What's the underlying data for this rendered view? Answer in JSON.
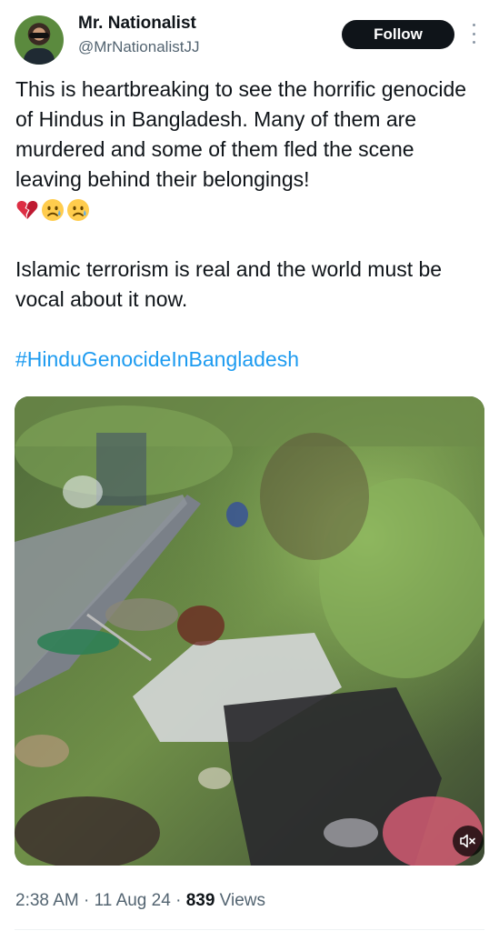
{
  "author": {
    "name": "Mr. Nationalist",
    "handle": "@MrNationalistJJ"
  },
  "follow_label": "Follow",
  "tweet": {
    "paragraph1": "This is heartbreaking to see the horrific genocide of Hindus in Bangladesh. Many of them are murdered and some of them fled the scene leaving behind their belongings!",
    "emojis": [
      "broken-heart-emoji",
      "sad-relieved-face-emoji",
      "sad-relieved-face-emoji"
    ],
    "paragraph2": "Islamic terrorism is real and the world must be vocal about it now.",
    "hashtag": "#HinduGenocideInBangladesh"
  },
  "meta": {
    "time": "2:38 AM",
    "sep1": " · ",
    "date": "11 Aug 24",
    "sep2": " · ",
    "views_count": "839",
    "views_label": " Views"
  },
  "icons": {
    "more": "more-vertical-icon",
    "mute": "volume-muted-icon"
  },
  "colors": {
    "text": "#0f1419",
    "secondary": "#536471",
    "link": "#1d9bf0",
    "button_bg": "#0f1419",
    "button_text": "#ffffff"
  }
}
